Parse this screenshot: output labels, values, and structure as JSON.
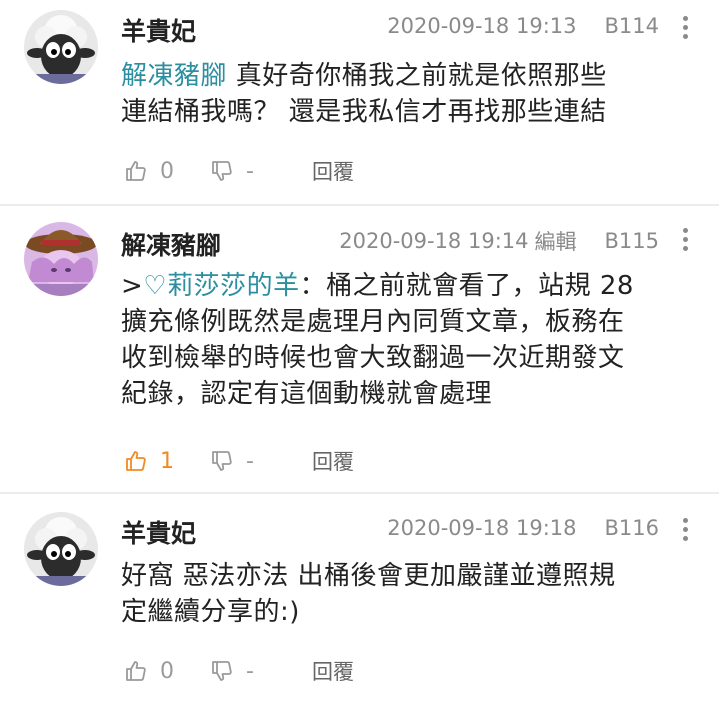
{
  "comments": [
    {
      "author": "羊貴妃",
      "datetime": "2020-09-18 19:13",
      "edited_label": "",
      "floor": "B114",
      "mention": "解凍豬腳",
      "text_line1": " 真好奇你桶我之前就是依照那些",
      "text_line2": "連結桶我嗎？ 還是我私信才再找那些連結",
      "text_line3": "",
      "text_line4": "",
      "likes": "0",
      "dislikes": "-",
      "reply_label": "回覆",
      "avatar_icon": "sheep-avatar-icon"
    },
    {
      "author": "解凍豬腳",
      "datetime": "2020-09-18 19:14",
      "edited_label": "編輯",
      "floor": "B115",
      "quote_prefix": ">",
      "mention": "♡莉莎莎的羊",
      "text_line1": "：桶之前就會看了，站規 28",
      "text_line2": "擴充條例既然是處理月內同質文章，板務在",
      "text_line3": "收到檢舉的時候也會大致翻過一次近期發文",
      "text_line4": "紀錄，認定有這個動機就會處理",
      "likes": "1",
      "dislikes": "-",
      "reply_label": "回覆",
      "avatar_icon": "pink-hat-avatar-icon"
    },
    {
      "author": "羊貴妃",
      "datetime": "2020-09-18 19:18",
      "edited_label": "",
      "floor": "B116",
      "text_line1": "好窩 惡法亦法 出桶後會更加嚴謹並遵照規",
      "text_line2": "定繼續分享的:)",
      "likes": "0",
      "dislikes": "-",
      "reply_label": "回覆",
      "avatar_icon": "sheep-avatar-icon"
    }
  ],
  "colors": {
    "link": "#2b8fa0",
    "liked": "#f08a24",
    "meta": "#8a8a8a"
  }
}
